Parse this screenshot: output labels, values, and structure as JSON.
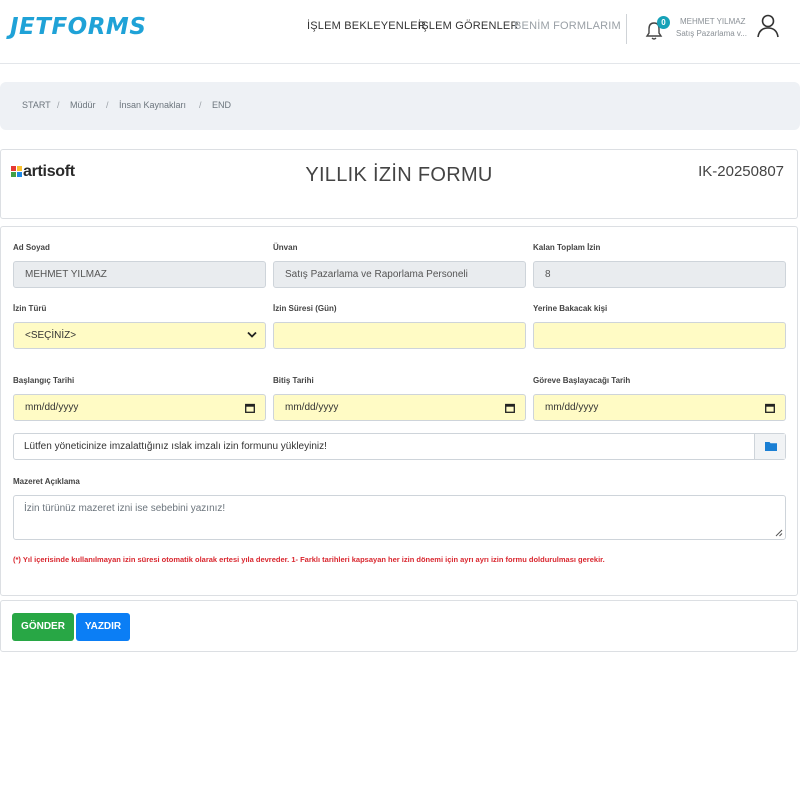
{
  "header": {
    "logo": "JETFORMS",
    "nav": [
      "İŞLEM BEKLEYENLER",
      "İŞLEM GÖRENLER",
      "BENİM FORMLARIM"
    ],
    "notification_count": "0",
    "user_name": "MEHMET YILMAZ",
    "user_title": "Satış Pazarlama v..."
  },
  "breadcrumb": [
    "START",
    "Müdür",
    "İnsan Kaynakları",
    "END"
  ],
  "breadcrumb_separator": "/",
  "form_header": {
    "brand": "artisoft",
    "title": "YILLIK İZİN FORMU",
    "code": "IK-20250807"
  },
  "fields": {
    "ad_soyad": {
      "label": "Ad Soyad",
      "value": "MEHMET YILMAZ"
    },
    "unvan": {
      "label": "Ünvan",
      "value": "Satış Pazarlama ve Raporlama Personeli"
    },
    "kalan_izin": {
      "label": "Kalan Toplam İzin",
      "value": "8"
    },
    "izin_turu": {
      "label": "İzin Türü",
      "value": "<SEÇİNİZ>"
    },
    "izin_suresi": {
      "label": "İzin Süresi (Gün)",
      "value": ""
    },
    "yerine_bakacak": {
      "label": "Yerine Bakacak kişi",
      "value": ""
    },
    "baslangic": {
      "label": "Başlangıç Tarihi",
      "placeholder": "mm/dd/yyyy"
    },
    "bitis": {
      "label": "Bitiş Tarihi",
      "placeholder": "mm/dd/yyyy"
    },
    "goreve_baslama": {
      "label": "Göreve Başlayacağı Tarih",
      "placeholder": "mm/dd/yyyy"
    }
  },
  "upload": {
    "text": "Lütfen yöneticinize imzalattığınız ıslak imzalı izin formunu yükleyiniz!"
  },
  "mazeret": {
    "label": "Mazeret Açıklama",
    "placeholder": "İzin türünüz mazeret izni ise sebebini yazınız!"
  },
  "note": "(*) Yıl içerisinde kullanılmayan izin süresi otomatik olarak ertesi yıla devreder. 1- Farklı tarihleri kapsayan her izin dönemi için ayrı ayrı izin formu doldurulması gerekir.",
  "buttons": {
    "send": "GÖNDER",
    "print": "YAZDIR"
  },
  "colors": {
    "accent": "#1fa2d7",
    "input_required": "#fffbc5",
    "send": "#28a745",
    "print": "#0b7ef5",
    "note": "#d9262e"
  }
}
